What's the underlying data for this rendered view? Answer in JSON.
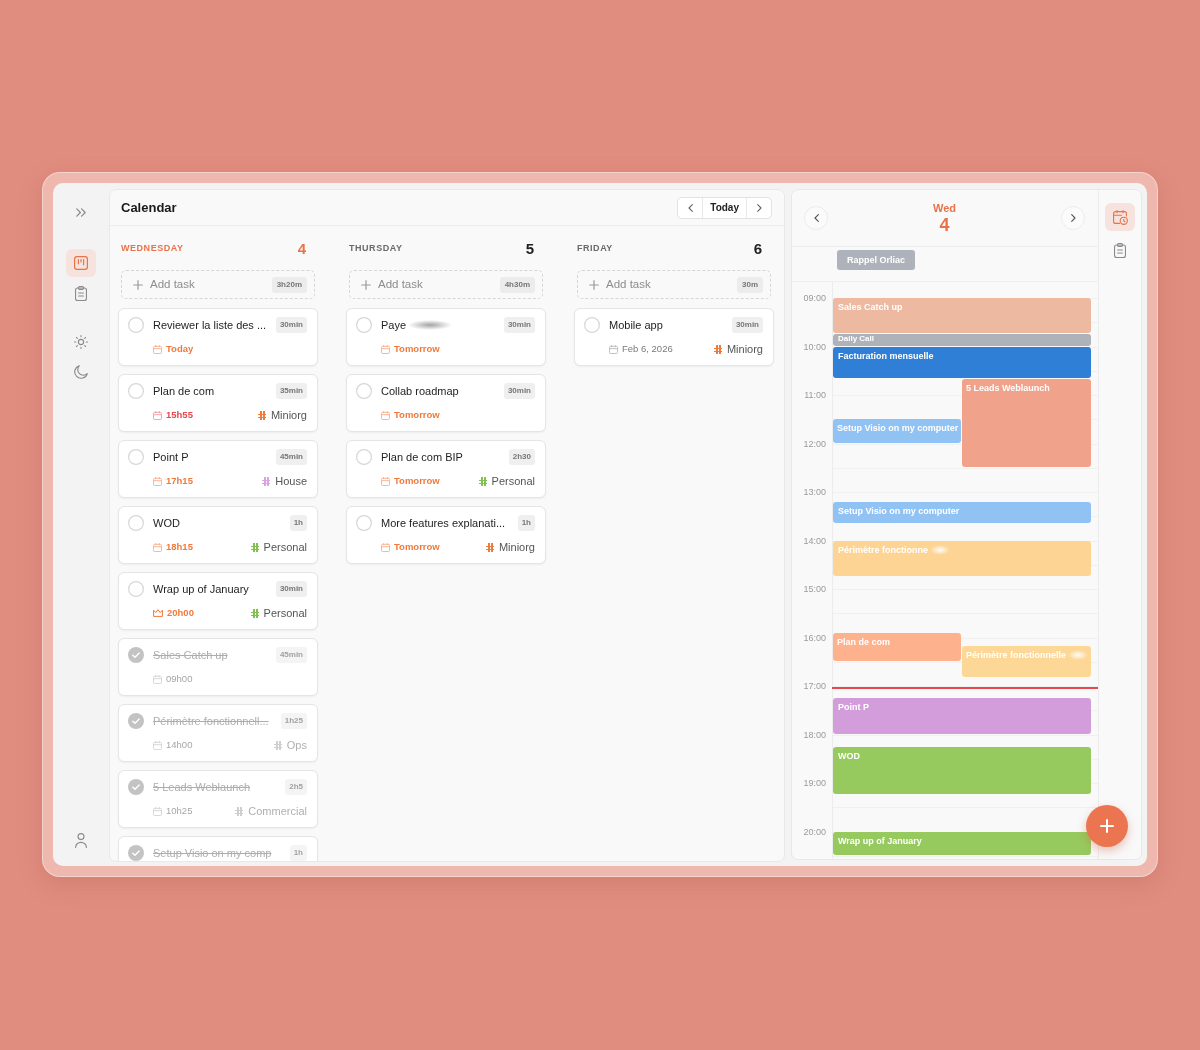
{
  "window": {
    "title": "Calendar"
  },
  "toolbar": {
    "today": "Today"
  },
  "left_nav": [
    {
      "kind": "board",
      "selected": true
    },
    {
      "kind": "tasks",
      "selected": false
    }
  ],
  "columns": [
    {
      "weekday": "WEDNESDAY",
      "day": "4",
      "selected": true,
      "add_task": "Add task",
      "total": "3h20m",
      "tasks": [
        {
          "kind": "upcoming",
          "title": "Reviewer la liste des ...",
          "duration": "30min",
          "checked": false,
          "date": "Today"
        },
        {
          "kind": "overdue",
          "title": "Plan de com",
          "duration": "35min",
          "checked": false,
          "date": "15h55",
          "tag": {
            "name": "Miniorg",
            "color": "#f07a3a"
          }
        },
        {
          "kind": "upcoming",
          "title": "Point P",
          "duration": "45min",
          "checked": false,
          "date": "17h15",
          "tag": {
            "name": "House",
            "color": "#dca3e3"
          }
        },
        {
          "kind": "upcoming",
          "title": "WOD",
          "duration": "1h",
          "checked": false,
          "date": "18h15",
          "tag": {
            "name": "Personal",
            "color": "#7fc24f"
          }
        },
        {
          "kind": "deadline",
          "title": "Wrap up of January",
          "duration": "30min",
          "checked": false,
          "date": "20h00",
          "tag": {
            "name": "Personal",
            "color": "#7fc24f"
          }
        },
        {
          "title": "Sales Catch up",
          "duration": "45min",
          "checked": true,
          "date": "09h00"
        },
        {
          "title": "Périmètre fonctionnell...",
          "duration": "1h25",
          "checked": true,
          "date": "14h00",
          "tag": {
            "name": "Ops",
            "color": "#cfcfcf"
          }
        },
        {
          "title": "5 Leads Weblaunch",
          "duration": "2h5",
          "checked": true,
          "date": "10h25",
          "tag": {
            "name": "Commercial",
            "color": "#cfcfcf"
          }
        },
        {
          "title": "Setup Visio on my comp",
          "duration": "1h",
          "checked": true
        }
      ]
    },
    {
      "weekday": "THURSDAY",
      "day": "5",
      "selected": false,
      "add_task": "Add task",
      "total": "4h30m",
      "tasks": [
        {
          "kind": "upcoming",
          "title": "Paye",
          "blurred": true,
          "duration": "30min",
          "checked": false,
          "date": "Tomorrow"
        },
        {
          "kind": "upcoming",
          "title": "Collab roadmap",
          "duration": "30min",
          "checked": false,
          "date": "Tomorrow"
        },
        {
          "kind": "upcoming",
          "title": "Plan de com BIP",
          "duration": "2h30",
          "checked": false,
          "date": "Tomorrow",
          "tag": {
            "name": "Personal",
            "color": "#7fc24f"
          }
        },
        {
          "kind": "upcoming",
          "title": "More features explanati...",
          "duration": "1h",
          "checked": false,
          "date": "Tomorrow",
          "tag": {
            "name": "Miniorg",
            "color": "#f07a3a"
          }
        }
      ]
    },
    {
      "weekday": "FRIDAY",
      "day": "6",
      "selected": false,
      "add_task": "Add task",
      "total": "30m",
      "tasks": [
        {
          "kind": "later",
          "title": "Mobile app",
          "duration": "30min",
          "checked": false,
          "date": "Feb 6, 2026",
          "tag": {
            "name": "Miniorg",
            "color": "#f07a3a"
          }
        }
      ]
    }
  ],
  "day_view": {
    "weekday": "Wed",
    "day": "4",
    "all_day": [
      {
        "title": "Rappel Orliac",
        "color": "#aeb2ba"
      }
    ],
    "hours": [
      "09:00",
      "10:00",
      "11:00",
      "12:00",
      "13:00",
      "14:00",
      "15:00",
      "16:00",
      "17:00",
      "18:00",
      "19:00",
      "20:00"
    ],
    "events": [
      {
        "title": "Sales Catch up",
        "color": "#edb9a1"
      },
      {
        "title": "Daily Call",
        "color": "#aeb2ba"
      },
      {
        "title": "Facturation mensuelle",
        "color": "#2f7fd6"
      },
      {
        "title": "5 Leads Weblaunch",
        "color": "#f1a28b"
      },
      {
        "title": "Setup Visio on my computer",
        "color": "#91c2f4"
      },
      {
        "title": "Setup Visio on my computer",
        "color": "#91c2f4"
      },
      {
        "title": "Périmètre fonctionne",
        "blurred": true,
        "color": "#fdd493"
      },
      {
        "title": "Plan de com",
        "color": "#fdb18c"
      },
      {
        "title": "Périmètre fonctionnelle",
        "blurred": true,
        "color": "#fdd796"
      },
      {
        "title": "Point P",
        "color": "#d39ddc"
      },
      {
        "title": "WOD",
        "color": "#97ca5e"
      },
      {
        "title": "Wrap up of January",
        "color": "#97ca5e"
      }
    ]
  },
  "right_nav": [
    {
      "kind": "schedule",
      "selected": true
    },
    {
      "kind": "tasks",
      "selected": false
    }
  ]
}
